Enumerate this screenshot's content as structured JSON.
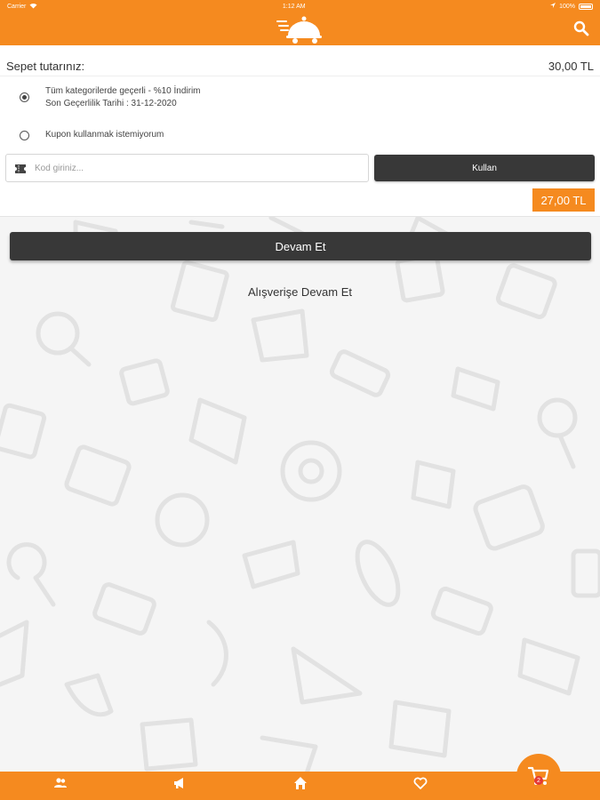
{
  "status_bar": {
    "carrier": "Carrier",
    "time": "1:12 AM",
    "battery": "100%"
  },
  "header": {
    "logo_icon": "cloche-delivery-logo",
    "search_icon": "search-icon"
  },
  "cart": {
    "total_label": "Sepet tutarınız:",
    "total_value": "30,00 TL"
  },
  "coupons": [
    {
      "line1": "Tüm kategorilerde geçerli - %10 İndirim",
      "line2": "Son Geçerlilik Tarihi : 31-12-2020",
      "selected": true
    },
    {
      "line1": "Kupon kullanmak istemiyorum",
      "selected": false
    }
  ],
  "code_input": {
    "placeholder": "Kod giriniz...",
    "value": ""
  },
  "use_button": "Kullan",
  "discounted_total": "27,00 TL",
  "continue_button": "Devam Et",
  "continue_shopping": "Alışverişe Devam Et",
  "bottom_nav": {
    "items": [
      "users-icon",
      "megaphone-icon",
      "home-icon",
      "heart-icon"
    ],
    "cart_icon": "cart-icon",
    "cart_count": "2"
  },
  "colors": {
    "accent": "#f58a1f",
    "dark_button": "#383838"
  }
}
